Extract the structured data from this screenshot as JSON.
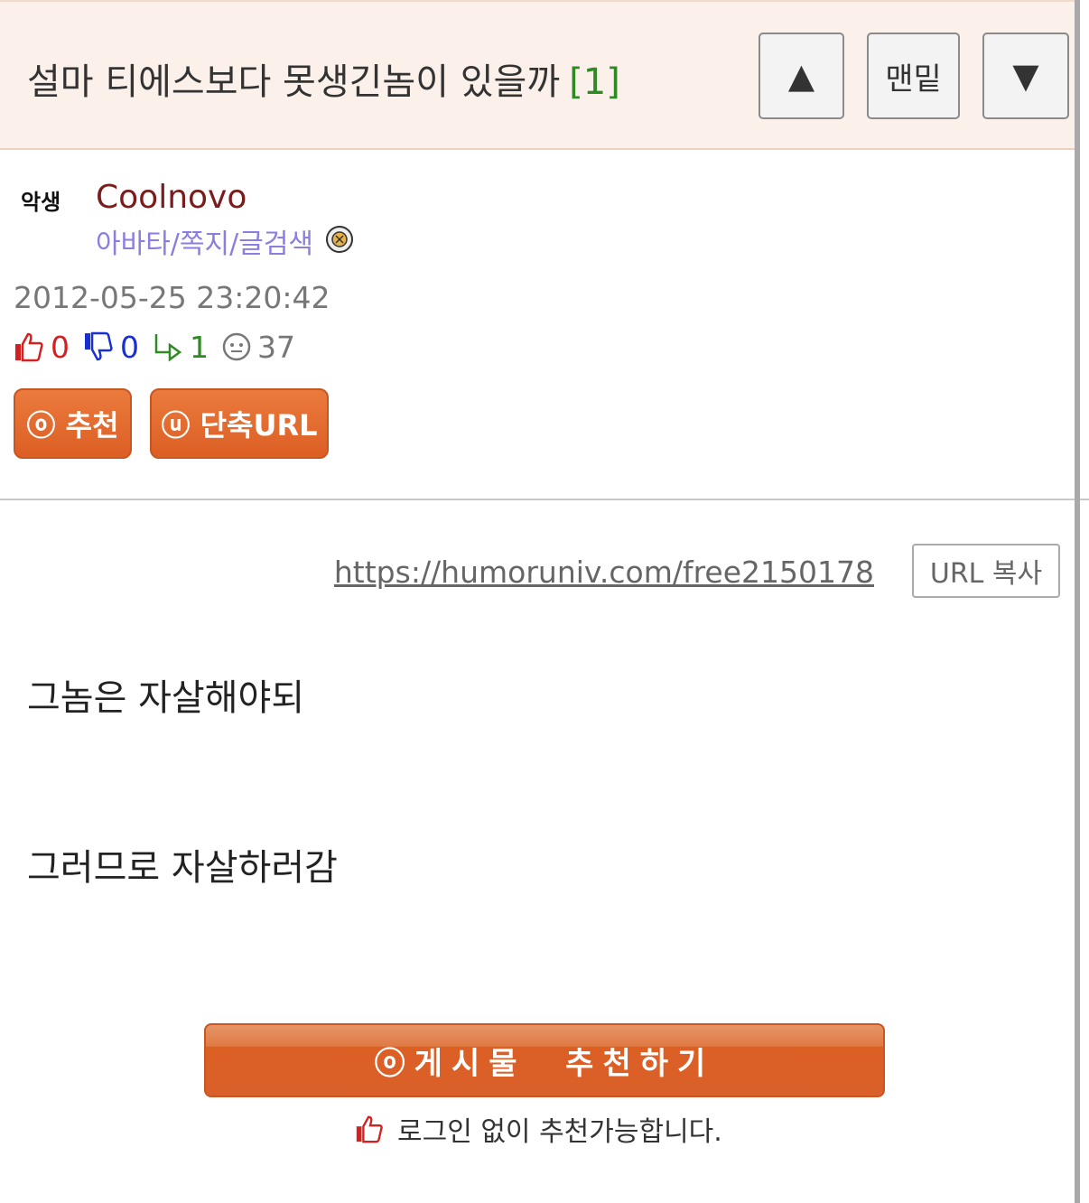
{
  "header": {
    "title": "설마 티에스보다 못생긴놈이 있을까",
    "comment_count": "[1]",
    "up_icon": "▲",
    "bottom_label": "맨밑",
    "down_icon": "▼"
  },
  "author": {
    "avatar_text": "악생",
    "name": "Coolnovo",
    "links": "아바타/쪽지/글검색",
    "level_icon": "level-badge-icon"
  },
  "post": {
    "datetime": "2012-05-25 23:20:42",
    "stats": {
      "upvotes": "0",
      "downvotes": "0",
      "replies": "1",
      "views": "37"
    },
    "recommend_label": "ⓞ 추천",
    "short_url_label": "ⓤ 단축URL",
    "url": "https://humoruniv.com/free2150178",
    "copy_url_label": "URL 복사",
    "body": [
      "그놈은 자살해야되",
      "그러므로 자살하러감"
    ],
    "recommend_post_label": "ⓞ게시물  추천하기",
    "notice": "로그인 없이 추천가능합니다."
  },
  "colors": {
    "accent": "#dc5f24",
    "header_bg": "#fbf1ea",
    "author_name": "#7a1c1c",
    "links": "#8a7ee0",
    "comment_count": "#2e8a22",
    "upvote": "#d32020",
    "downvote": "#1a2fd0"
  }
}
